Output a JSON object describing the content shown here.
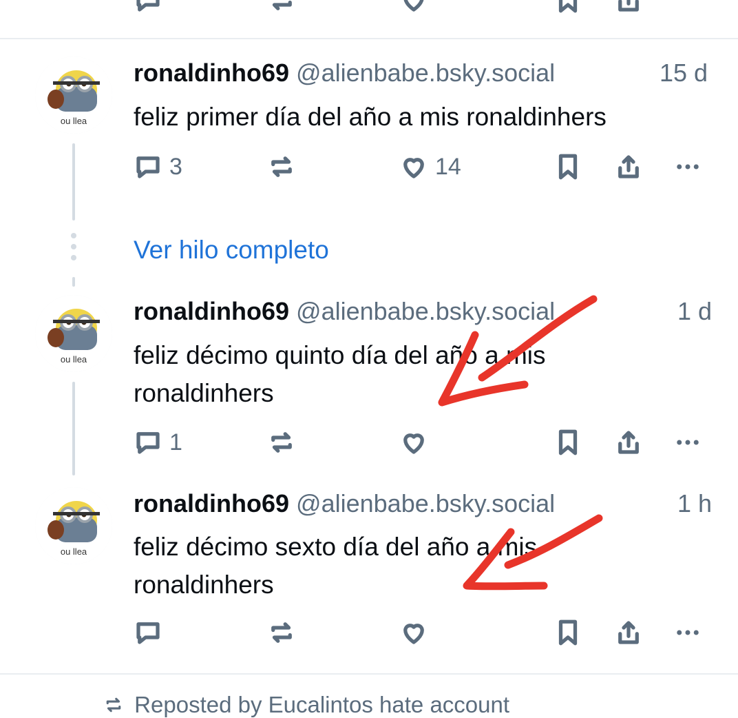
{
  "posts": [
    {
      "author": "ronaldinho69",
      "handle": "@alienbabe.bsky.social",
      "time": "15 d",
      "text": "feliz primer día del año a mis ronaldinhers",
      "reply_count": "3",
      "like_count": "14"
    },
    {
      "author": "ronaldinho69",
      "handle": "@alienbabe.bsky.social",
      "time": "1 d",
      "text_line1": "feliz décimo quinto día del año a mis",
      "text_line2": "ronaldinhers",
      "reply_count": "1",
      "like_count": ""
    },
    {
      "author": "ronaldinho69",
      "handle": "@alienbabe.bsky.social",
      "time": "1 h",
      "text_line1": "feliz décimo sexto día del año a mis",
      "text_line2": "ronaldinhers",
      "reply_count": "",
      "like_count": ""
    }
  ],
  "avatar_caption": "ou llea",
  "thread_link": "Ver hilo completo",
  "repost_banner": "Reposted by Eucalintos hate account",
  "icons": [
    "reply-icon",
    "repost-icon",
    "like-icon",
    "bookmark-icon",
    "share-icon",
    "more-icon",
    "repost-small-icon"
  ],
  "colors": {
    "link": "#1f73d8",
    "muted": "#5b6c7d",
    "annotation": "#e8352a"
  }
}
